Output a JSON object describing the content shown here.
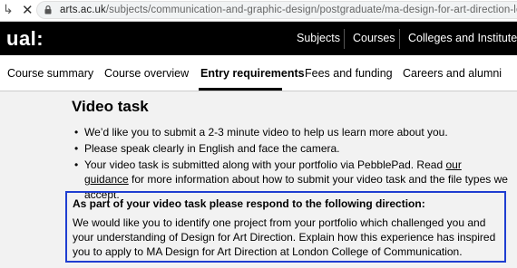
{
  "browser": {
    "url_domain": "arts.ac.uk",
    "url_path": "/subjects/communication-and-graphic-design/postgraduate/ma-design-for-art-direction-lcc",
    "icons": [
      "arrow-icon",
      "close-icon",
      "lock-icon"
    ]
  },
  "header": {
    "logo": "ual:",
    "nav": [
      "Subjects",
      "Courses",
      "Colleges and Institutes"
    ]
  },
  "tabs": {
    "items": [
      "Course summary",
      "Course overview",
      "Entry requirements",
      "Fees and funding",
      "Careers and alumni"
    ],
    "active": "Entry requirements"
  },
  "main": {
    "title": "Video task",
    "bullets": {
      "b1": "We’d like you to submit a 2-3 minute video to help us learn more about you.",
      "b2": "Please speak clearly in English and face the camera.",
      "b3_pre": "Your video task is submitted along with your portfolio via PebblePad. Read ",
      "b3_link": "our guidance",
      "b3_post": " for more information about how to submit your video task and the file types we accept."
    },
    "callout": {
      "heading": "As part of your video task please respond to the following direction:",
      "body": "We would like you to identify one project from your portfolio which challenged you and your understanding of Design for Art Direction. Explain how this experience has inspired you to apply to MA Design for Art Direction at London College of Communication."
    }
  },
  "colors": {
    "header_bg": "#000000",
    "page_bg": "#f2f2f2",
    "callout_border": "#1f3ed1"
  }
}
